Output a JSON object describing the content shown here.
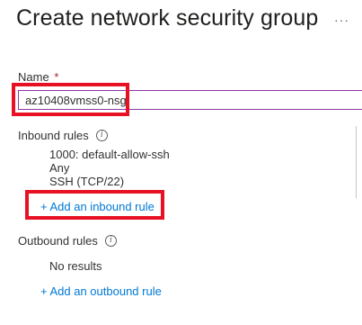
{
  "page": {
    "title": "Create network security group",
    "more_label": "···"
  },
  "name_field": {
    "label": "Name",
    "required_marker": "*",
    "value": "az10408vmss0-nsg"
  },
  "inbound": {
    "label": "Inbound rules",
    "info_icon": "info-icon",
    "rules": [
      {
        "name": "1000: default-allow-ssh",
        "source": "Any",
        "service": "SSH (TCP/22)"
      }
    ],
    "add_link": "+ Add an inbound rule"
  },
  "outbound": {
    "label": "Outbound rules",
    "info_icon": "info-icon",
    "empty_text": "No results",
    "add_link": "+ Add an outbound rule"
  },
  "colors": {
    "highlight": "#e81123",
    "link": "#0078d4",
    "input_border": "#8a3aa6"
  }
}
